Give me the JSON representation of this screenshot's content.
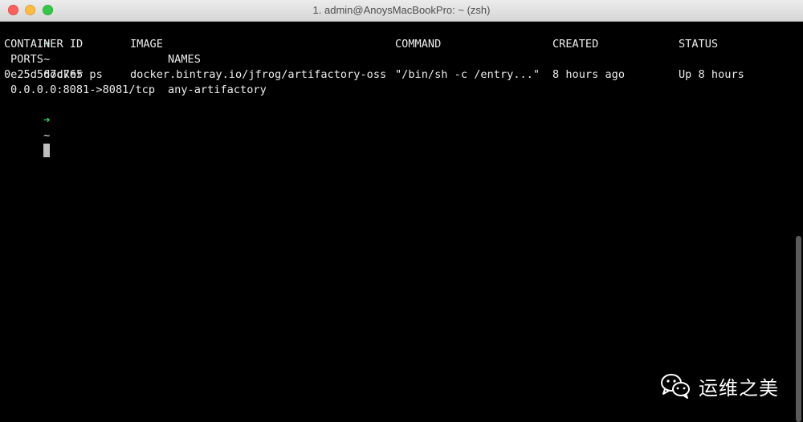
{
  "window": {
    "title": "1. admin@AnoysMacBookPro: ~ (zsh)"
  },
  "terminal": {
    "prompt_symbol": "➜",
    "prompt_dir": "~",
    "command": "docker ps",
    "headers": {
      "container_id": "CONTAINER ID",
      "image": "IMAGE",
      "command": "COMMAND",
      "created": "CREATED",
      "status": "STATUS",
      "ports": "PORTS",
      "names": "NAMES"
    },
    "rows": [
      {
        "container_id": "0e25d567d765",
        "image": "docker.bintray.io/jfrog/artifactory-oss",
        "command": "\"/bin/sh -c /entry...\"",
        "created": "8 hours ago",
        "status": "Up 8 hours",
        "ports": "0.0.0.0:8081->8081/tcp",
        "names": "any-artifactory"
      }
    ]
  },
  "watermark": {
    "text": "运维之美",
    "icon": "wechat-icon"
  },
  "colors": {
    "prompt_arrow": "#3cd36a",
    "text": "#ececec",
    "background": "#000000"
  }
}
